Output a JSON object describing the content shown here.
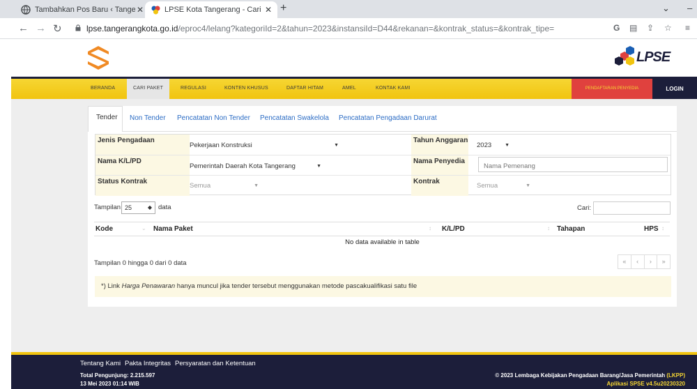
{
  "browser": {
    "tabs": [
      {
        "title": "Tambahkan Pos Baru ‹ Tangerang",
        "active": false
      },
      {
        "title": "LPSE Kota Tangerang - Cari Paket",
        "active": true
      }
    ],
    "url_host": "lpse.tangerangkota.go.id",
    "url_path": "/eproc4/lelang?kategoriId=2&tahun=2023&instansiId=D44&rekanan=&kontrak_status=&kontrak_tipe="
  },
  "site": {
    "logo_text": "LPSE",
    "menu": [
      "BERANDA",
      "CARI PAKET",
      "REGULASI",
      "KONTEN KHUSUS",
      "DAFTAR HITAM",
      "AMEL",
      "KONTAK KAMI"
    ],
    "menu_active": "CARI PAKET",
    "register_label": "PENDAFTARAN PENYEDIA",
    "login_label": "LOGIN"
  },
  "tabs": [
    "Tender",
    "Non Tender",
    "Pencatatan Non Tender",
    "Pencatatan Swakelola",
    "Pencatatan Pengadaan Darurat"
  ],
  "filters": {
    "jenis_label": "Jenis Pengadaan",
    "jenis_value": "Pekerjaan Konstruksi",
    "tahun_label": "Tahun Anggaran",
    "tahun_value": "2023",
    "nama_kl_label": "Nama K/L/PD",
    "nama_kl_value": "Pemerintah Daerah Kota Tangerang",
    "penyedia_label": "Nama Penyedia",
    "penyedia_placeholder": "Nama Pemenang",
    "status_label": "Status Kontrak",
    "status_value": "Semua",
    "kontrak_label": "Kontrak",
    "kontrak_value": "Semua"
  },
  "table": {
    "show_label": "Tampilan",
    "page_size": "25",
    "data_label": "data",
    "search_label": "Cari:",
    "columns": [
      "Kode",
      "Nama Paket",
      "K/L/PD",
      "Tahapan",
      "HPS"
    ],
    "empty_message": "No data available in table",
    "info": "Tampilan 0 hingga 0 dari 0 data",
    "pager": [
      "«",
      "‹",
      "›",
      "»"
    ]
  },
  "note": {
    "prefix": "*) Link ",
    "italic": "Harga Penawaran",
    "suffix": " hanya muncul jika tender tersebut menggunakan metode pascakualifikasi satu file"
  },
  "footer": {
    "links": [
      "Tentang Kami",
      "Pakta Integritas",
      "Persyaratan dan Ketentuan"
    ],
    "visitors": "Total Pengunjung: 2.215.597",
    "datetime": "13 Mei 2023 01:14 WIB",
    "copyright": "© 2023 Lembaga Kebijakan Pengadaan Barang/Jasa Pemerintah",
    "copyright_org": "(LKPP)",
    "app_version": "Aplikasi SPSE v4.5u20230320"
  },
  "colors": {
    "menu_yellow": "#f1c40f",
    "navy": "#1c1e3a",
    "register_red": "#e0413e",
    "link_blue": "#2a6bc4",
    "label_bg": "#fcf8e3"
  }
}
